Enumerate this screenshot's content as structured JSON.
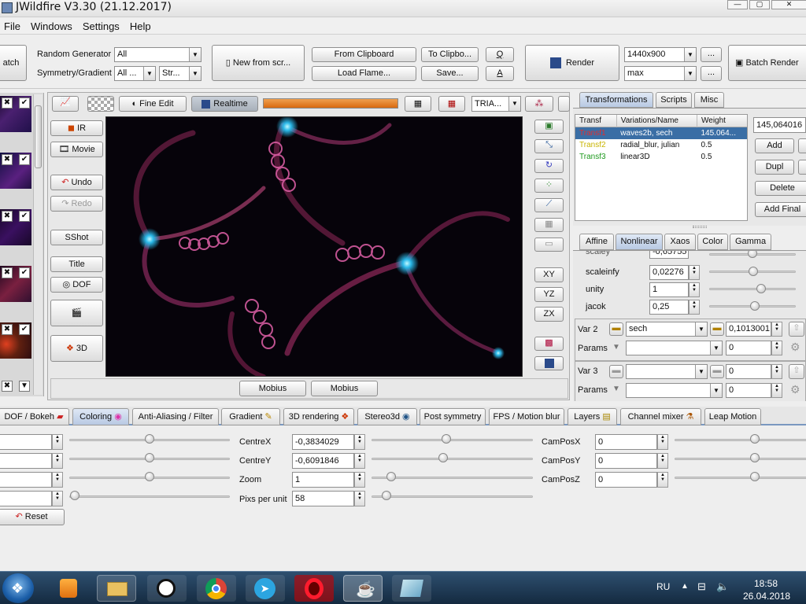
{
  "title": "JWildfire V3.30 (21.12.2017)",
  "menu": [
    "File",
    "Windows",
    "Settings",
    "Help"
  ],
  "toolbar": {
    "batch_partial": "atch",
    "random_gen_label": "Random Generator",
    "random_gen_value": "All",
    "symmetry_label": "Symmetry/Gradient",
    "symmetry_value": "All ...",
    "gradient_value": "Str...",
    "new_from_script": "New from scr...",
    "from_clipboard": "From Clipboard",
    "to_clipboard": "To Clipbo...",
    "q": "Q",
    "load_flame": "Load Flame...",
    "save": "Save...",
    "a": "A",
    "render": "Render",
    "resolution": "1440x900",
    "quality": "max",
    "dots": "...",
    "batch_render": "Batch Render"
  },
  "preview_toolbar": {
    "fine_edit": "Fine Edit",
    "realtime": "Realtime",
    "tria": "TRIA...",
    "progress": 1.0
  },
  "left_buttons": {
    "ir": "IR",
    "movie": "Movie",
    "undo": "Undo",
    "redo": "Redo",
    "sshot": "SShot",
    "title": "Title",
    "dof": "DOF",
    "threed": "3D"
  },
  "right_icons": {
    "xy": "XY",
    "yz": "YZ",
    "zx": "ZX"
  },
  "bottom_buttons": {
    "mobius1": "Mobius",
    "mobius2": "Mobius"
  },
  "right_tabs": [
    "Transformations",
    "Scripts",
    "Misc"
  ],
  "transf_table": {
    "headers": [
      "Transf",
      "Variations/Name",
      "Weight"
    ],
    "rows": [
      {
        "name": "Transf1",
        "vars": "waves2b, sech",
        "weight": "145.064...",
        "color": "#c0202a"
      },
      {
        "name": "Transf2",
        "vars": "radial_blur, julian",
        "weight": "0.5",
        "color": "#c8b400"
      },
      {
        "name": "Transf3",
        "vars": "linear3D",
        "weight": "0.5",
        "color": "#1e9a1e"
      }
    ]
  },
  "transf_side": {
    "weight_value": "145,064016",
    "add": "Add",
    "dupl": "Dupl",
    "delete": "Delete",
    "add_final": "Add Final"
  },
  "sub_tabs": [
    "Affine",
    "Nonlinear",
    "Xaos",
    "Color",
    "Gamma"
  ],
  "nonlinear": {
    "partial_label": "scaley",
    "partial_value": "-0,65755",
    "rows": [
      {
        "label": "scaleinfy",
        "value": "0,02276"
      },
      {
        "label": "unity",
        "value": "1"
      },
      {
        "label": "jacok",
        "value": "0,25"
      }
    ],
    "var2_label": "Var 2",
    "var2_value": "sech",
    "var2_amount": "0,1013001",
    "params_label": "Params",
    "params2_value": "0",
    "var3_label": "Var 3",
    "var3_amount": "0",
    "params3_value": "0"
  },
  "bottom_tabs": [
    "DOF / Bokeh",
    "Coloring",
    "Anti-Aliasing / Filter",
    "Gradient",
    "3D rendering",
    "Stereo3d",
    "Post symmetry",
    "FPS / Motion blur",
    "Layers",
    "Channel mixer",
    "Leap Motion"
  ],
  "camera": {
    "centrex_label": "CentreX",
    "centrex_value": "-0,3834029",
    "centrey_label": "CentreY",
    "centrey_value": "-0,6091846",
    "zoom_label": "Zoom",
    "zoom_value": "1",
    "pixs_label": "Pixs per unit",
    "pixs_value": "58",
    "camposx_label": "CamPosX",
    "camposx_value": "0",
    "camposy_label": "CamPosY",
    "camposy_value": "0",
    "camposz_label": "CamPosZ",
    "camposz_value": "0",
    "reset": "Reset"
  },
  "taskbar": {
    "lang": "RU",
    "time": "18:58",
    "date": "26.04.2018"
  }
}
